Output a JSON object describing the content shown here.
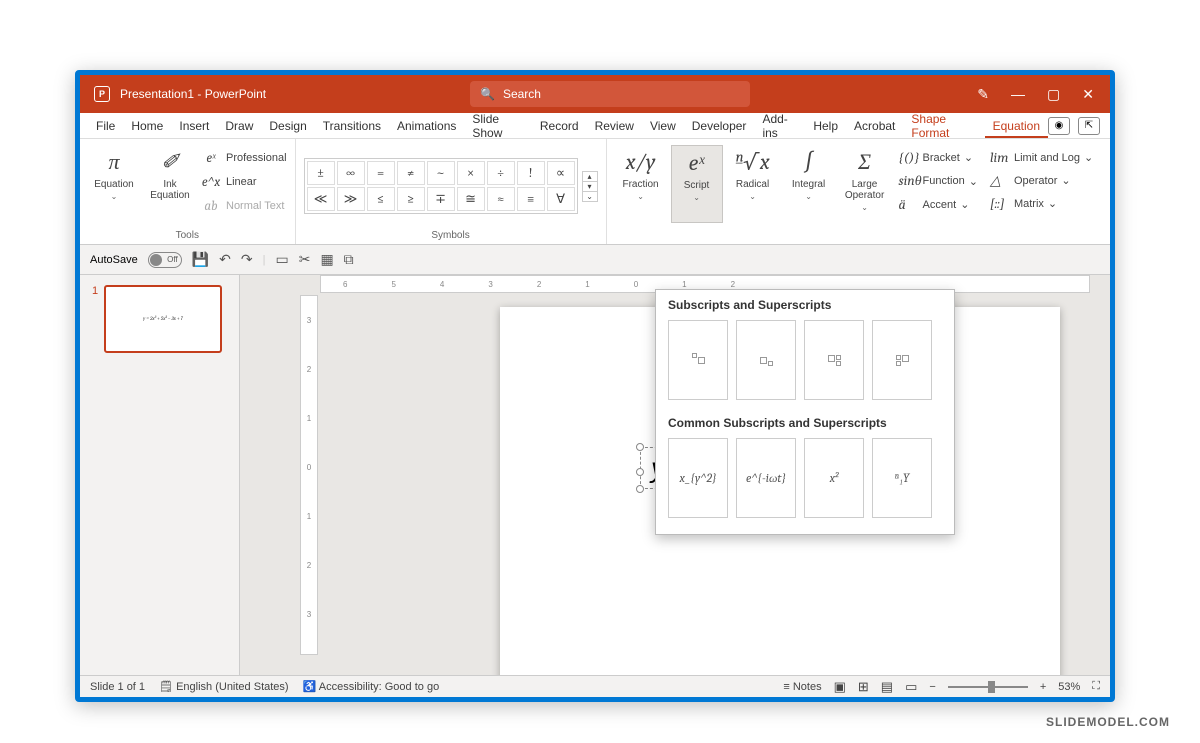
{
  "title": "Presentation1 - PowerPoint",
  "search_placeholder": "Search",
  "tabs": [
    "File",
    "Home",
    "Insert",
    "Draw",
    "Design",
    "Transitions",
    "Animations",
    "Slide Show",
    "Record",
    "Review",
    "View",
    "Developer",
    "Add-ins",
    "Help",
    "Acrobat"
  ],
  "context_tabs": {
    "shape": "Shape Format",
    "equation": "Equation"
  },
  "ribbon": {
    "tools": {
      "equation": "Equation",
      "ink": "Ink\nEquation",
      "professional": "Professional",
      "linear": "Linear",
      "normal": "Normal Text",
      "label": "Tools"
    },
    "symbols": {
      "row1": [
        "±",
        "∞",
        "=",
        "≠",
        "~",
        "×",
        "÷",
        "!",
        "∝",
        "<"
      ],
      "row2": [
        "≪",
        "≫",
        "≤",
        "≥",
        "∓",
        "≅",
        "≈",
        "≡",
        "∀"
      ],
      "label": "Symbols"
    },
    "structures": {
      "fraction": "Fraction",
      "script": "Script",
      "radical": "Radical",
      "integral": "Integral",
      "large": "Large\nOperator",
      "bracket": "Bracket",
      "function": "Function",
      "accent": "Accent",
      "limit": "Limit and Log",
      "operator": "Operator",
      "matrix": "Matrix",
      "ico_fraction": "x/y",
      "ico_script": "eˣ",
      "ico_radical": "ⁿ√x",
      "ico_integral": "∫",
      "ico_large": "Σ",
      "ico_bracket": "{()}",
      "ico_function": "sinθ",
      "ico_accent": "ä",
      "ico_limit": "lim",
      "ico_operator": "△",
      "ico_matrix": "[::]"
    }
  },
  "qat": {
    "autosave": "AutoSave",
    "off": "Off"
  },
  "dropdown": {
    "section1": "Subscripts and Superscripts",
    "section2": "Common Subscripts and Superscripts",
    "common": [
      "x_{y^2}",
      "e^{-iωt}",
      "x²",
      "ⁿ₁Y"
    ]
  },
  "slide_equation": "y = 2x³",
  "thumb_equation": "y = 2x³ + 5x² – 3x + 7",
  "status": {
    "slide": "Slide 1 of 1",
    "lang": "English (United States)",
    "a11y": "Accessibility: Good to go",
    "notes": "Notes",
    "zoom": "53%"
  },
  "slide_number": "1",
  "watermark": "SLIDEMODEL.COM"
}
